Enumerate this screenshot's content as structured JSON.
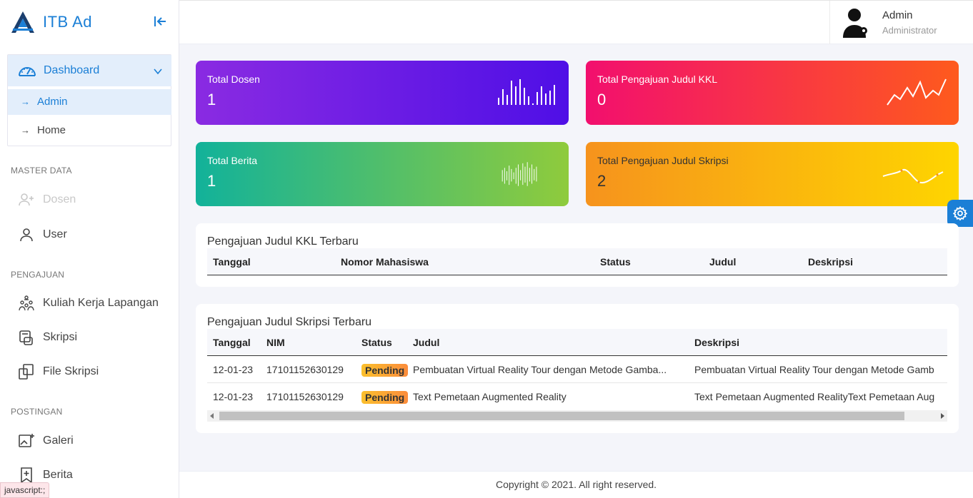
{
  "brand": {
    "name": "ITB Ad",
    "logo_icon": "itb-logo-icon",
    "collapse_icon": "collapse-left-icon",
    "accent": "#1b7fd6"
  },
  "sidebar": {
    "dashboard": {
      "label": "Dashboard",
      "icon": "speedometer-icon",
      "sub": [
        {
          "label": "Admin"
        },
        {
          "label": "Home"
        }
      ]
    },
    "sections": [
      {
        "title": "MASTER DATA",
        "items": [
          {
            "label": "Dosen",
            "icon": "user-plus-icon",
            "disabled": true
          },
          {
            "label": "User",
            "icon": "user-icon"
          }
        ]
      },
      {
        "title": "PENGAJUAN",
        "items": [
          {
            "label": "Kuliah Kerja Lapangan",
            "icon": "group-icon"
          },
          {
            "label": "Skripsi",
            "icon": "scroll-icon"
          },
          {
            "label": "File Skripsi",
            "icon": "files-icon"
          }
        ]
      },
      {
        "title": "POSTINGAN",
        "items": [
          {
            "label": "Galeri",
            "icon": "image-add-icon"
          },
          {
            "label": "Berita",
            "icon": "bookmark-add-icon"
          }
        ]
      }
    ]
  },
  "header": {
    "user_name": "Admin",
    "user_role": "Administrator"
  },
  "stats": [
    {
      "title": "Total Dosen",
      "value": "1"
    },
    {
      "title": "Total Pengajuan Judul KKL",
      "value": "0"
    },
    {
      "title": "Total Berita",
      "value": "1"
    },
    {
      "title": "Total Pengajuan Judul Skripsi",
      "value": "2"
    }
  ],
  "kkl_table": {
    "title": "Pengajuan Judul KKL Terbaru",
    "columns": [
      "Tanggal",
      "Nomor Mahasiswa",
      "Status",
      "Judul",
      "Deskripsi"
    ],
    "rows": []
  },
  "skripsi_table": {
    "title": "Pengajuan Judul Skripsi Terbaru",
    "columns": [
      "Tanggal",
      "NIM",
      "Status",
      "Judul",
      "Deskripsi"
    ],
    "rows": [
      [
        "12-01-23",
        "17101152630129",
        "Pending",
        "Pembuatan Virtual Reality Tour dengan Metode Gamba...",
        "Pembuatan Virtual Reality Tour dengan Metode Gamb"
      ],
      [
        "12-01-23",
        "17101152630129",
        "Pending",
        "Text Pemetaan Augmented Reality",
        "Text Pemetaan Augmented RealityText Pemetaan Aug"
      ]
    ]
  },
  "footer": {
    "text": "Copyright © 2021. All right reserved."
  },
  "status_tooltip": "javascript:;",
  "settings_fab_icon": "gear-icon"
}
